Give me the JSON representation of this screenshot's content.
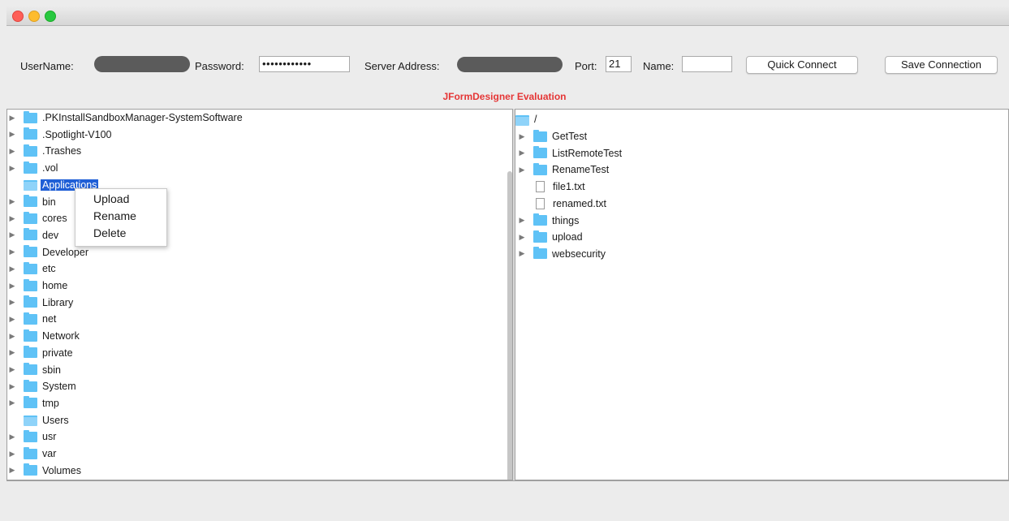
{
  "window": {
    "traffic_lights": [
      "close",
      "minimize",
      "zoom"
    ]
  },
  "connection": {
    "username_label": "UserName:",
    "password_label": "Password:",
    "password_value": "••••••••••••",
    "server_label": "Server Address:",
    "port_label": "Port:",
    "port_value": "21",
    "name_label": "Name:",
    "name_value": "",
    "quick_connect": "Quick Connect",
    "save_connection": "Save Connection"
  },
  "banner": "JFormDesigner Evaluation",
  "local_tree": {
    "items": [
      {
        "label": ".PKInstallSandboxManager-SystemSoftware",
        "expandable": true
      },
      {
        "label": ".Spotlight-V100",
        "expandable": true
      },
      {
        "label": ".Trashes",
        "expandable": true
      },
      {
        "label": ".vol",
        "expandable": true
      },
      {
        "label": "Applications",
        "expandable": false,
        "selected": true
      },
      {
        "label": "bin",
        "expandable": true
      },
      {
        "label": "cores",
        "expandable": true
      },
      {
        "label": "dev",
        "expandable": true
      },
      {
        "label": "Developer",
        "expandable": true
      },
      {
        "label": "etc",
        "expandable": true
      },
      {
        "label": "home",
        "expandable": true
      },
      {
        "label": "Library",
        "expandable": true
      },
      {
        "label": "net",
        "expandable": true
      },
      {
        "label": "Network",
        "expandable": true
      },
      {
        "label": "private",
        "expandable": true
      },
      {
        "label": "sbin",
        "expandable": true
      },
      {
        "label": "System",
        "expandable": true
      },
      {
        "label": "tmp",
        "expandable": true
      },
      {
        "label": "Users",
        "expandable": false
      },
      {
        "label": "usr",
        "expandable": true
      },
      {
        "label": "var",
        "expandable": true
      },
      {
        "label": "Volumes",
        "expandable": true
      }
    ]
  },
  "context_menu": {
    "items": [
      "Upload",
      "Rename",
      "Delete"
    ]
  },
  "remote_tree": {
    "root": "/",
    "items": [
      {
        "label": "GetTest",
        "type": "folder"
      },
      {
        "label": "ListRemoteTest",
        "type": "folder"
      },
      {
        "label": "RenameTest",
        "type": "folder"
      },
      {
        "label": "file1.txt",
        "type": "file"
      },
      {
        "label": "renamed.txt",
        "type": "file"
      },
      {
        "label": "things",
        "type": "folder"
      },
      {
        "label": "upload",
        "type": "folder"
      },
      {
        "label": "websecurity",
        "type": "folder"
      }
    ]
  },
  "colors": {
    "selection": "#1f5fd6",
    "folder": "#5fc2f6",
    "banner": "#e53636"
  }
}
